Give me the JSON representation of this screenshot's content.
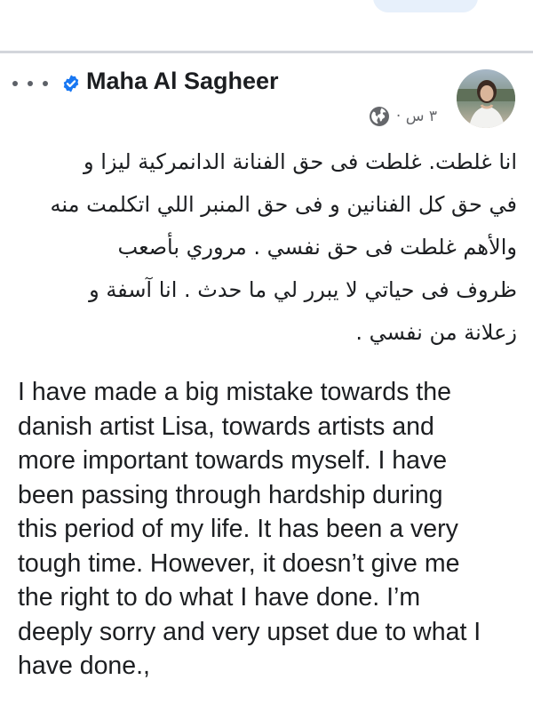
{
  "post": {
    "author_name": "Maha Al Sagheer",
    "time": "٣ س ·",
    "arabic_lines": "انا غلطت. غلطت فى حق الفنانة الدانمركية ليزا و\nفي حق كل الفنانين و فى حق المنبر اللي اتكلمت منه\nوالأهم غلطت فى حق نفسي . مروري بأصعب\nظروف فى حياتي لا يبرر لي ما حدث . انا آسفة و\nزعلانة من نفسي .",
    "english_lines": "I have made a big mistake towards the\ndanish artist Lisa,  towards artists and\nmore important towards myself. I have\nbeen passing through hardship during\nthis period of my life. It has been a very\ntough time. However, it doesn’t give me\nthe right to do what I have done. I’m\ndeeply sorry and very upset due to what I\nhave done.,"
  },
  "icons": {
    "more": "more-dots-icon",
    "verified": "verified-badge-icon",
    "audience": "globe-icon"
  },
  "colors": {
    "verified_blue": "#1877f2",
    "meta_gray": "#65676b",
    "text": "#1c1e21",
    "divider": "#d3d6db"
  }
}
